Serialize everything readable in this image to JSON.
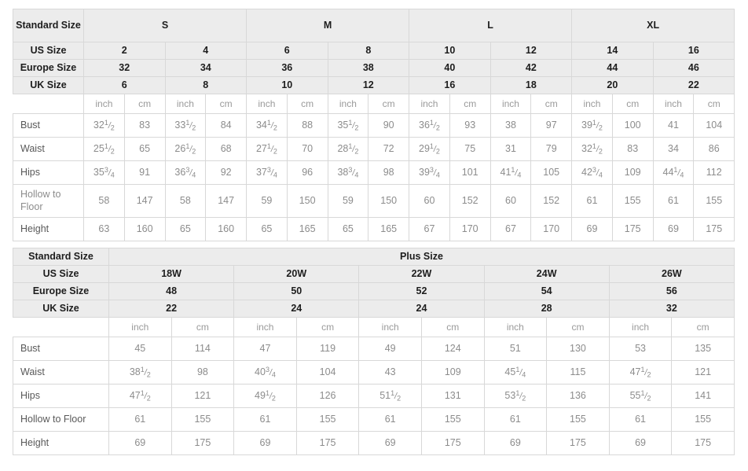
{
  "standard_table": {
    "label_header": "Standard Size",
    "size_groups": [
      {
        "name": "S",
        "span": 4
      },
      {
        "name": "M",
        "span": 4
      },
      {
        "name": "L",
        "span": 4
      },
      {
        "name": "XL",
        "span": 4
      }
    ],
    "size_rows": [
      {
        "label": "US Size",
        "values": [
          "2",
          "4",
          "6",
          "8",
          "10",
          "12",
          "14",
          "16"
        ]
      },
      {
        "label": "Europe Size",
        "values": [
          "32",
          "34",
          "36",
          "38",
          "40",
          "42",
          "44",
          "46"
        ]
      },
      {
        "label": "UK Size",
        "values": [
          "6",
          "8",
          "10",
          "12",
          "16",
          "18",
          "20",
          "22"
        ]
      }
    ],
    "unit_row": {
      "label": "",
      "units": [
        "inch",
        "cm",
        "inch",
        "cm",
        "inch",
        "cm",
        "inch",
        "cm",
        "inch",
        "cm",
        "inch",
        "cm",
        "inch",
        "cm",
        "inch",
        "cm"
      ]
    },
    "measure_rows": [
      {
        "label": "Bust",
        "tall": false,
        "cells": [
          {
            "whole": "32",
            "num": "1",
            "den": "2"
          },
          {
            "whole": "83"
          },
          {
            "whole": "33",
            "num": "1",
            "den": "2"
          },
          {
            "whole": "84"
          },
          {
            "whole": "34",
            "num": "1",
            "den": "2"
          },
          {
            "whole": "88"
          },
          {
            "whole": "35",
            "num": "1",
            "den": "2"
          },
          {
            "whole": "90"
          },
          {
            "whole": "36",
            "num": "1",
            "den": "2"
          },
          {
            "whole": "93"
          },
          {
            "whole": "38"
          },
          {
            "whole": "97"
          },
          {
            "whole": "39",
            "num": "1",
            "den": "2"
          },
          {
            "whole": "100"
          },
          {
            "whole": "41"
          },
          {
            "whole": "104"
          }
        ]
      },
      {
        "label": "Waist",
        "tall": false,
        "cells": [
          {
            "whole": "25",
            "num": "1",
            "den": "2"
          },
          {
            "whole": "65"
          },
          {
            "whole": "26",
            "num": "1",
            "den": "2"
          },
          {
            "whole": "68"
          },
          {
            "whole": "27",
            "num": "1",
            "den": "2"
          },
          {
            "whole": "70"
          },
          {
            "whole": "28",
            "num": "1",
            "den": "2"
          },
          {
            "whole": "72"
          },
          {
            "whole": "29",
            "num": "1",
            "den": "2"
          },
          {
            "whole": "75"
          },
          {
            "whole": "31"
          },
          {
            "whole": "79"
          },
          {
            "whole": "32",
            "num": "1",
            "den": "2"
          },
          {
            "whole": "83"
          },
          {
            "whole": "34"
          },
          {
            "whole": "86"
          }
        ]
      },
      {
        "label": "Hips",
        "tall": false,
        "cells": [
          {
            "whole": "35",
            "num": "3",
            "den": "4"
          },
          {
            "whole": "91"
          },
          {
            "whole": "36",
            "num": "3",
            "den": "4"
          },
          {
            "whole": "92"
          },
          {
            "whole": "37",
            "num": "3",
            "den": "4"
          },
          {
            "whole": "96"
          },
          {
            "whole": "38",
            "num": "3",
            "den": "4"
          },
          {
            "whole": "98"
          },
          {
            "whole": "39",
            "num": "3",
            "den": "4"
          },
          {
            "whole": "101"
          },
          {
            "whole": "41",
            "num": "1",
            "den": "4"
          },
          {
            "whole": "105"
          },
          {
            "whole": "42",
            "num": "3",
            "den": "4"
          },
          {
            "whole": "109"
          },
          {
            "whole": "44",
            "num": "1",
            "den": "4"
          },
          {
            "whole": "112"
          }
        ]
      },
      {
        "label": "Hollow to Floor",
        "tall": true,
        "cells": [
          {
            "whole": "58"
          },
          {
            "whole": "147"
          },
          {
            "whole": "58"
          },
          {
            "whole": "147"
          },
          {
            "whole": "59"
          },
          {
            "whole": "150"
          },
          {
            "whole": "59"
          },
          {
            "whole": "150"
          },
          {
            "whole": "60"
          },
          {
            "whole": "152"
          },
          {
            "whole": "60"
          },
          {
            "whole": "152"
          },
          {
            "whole": "61"
          },
          {
            "whole": "155"
          },
          {
            "whole": "61"
          },
          {
            "whole": "155"
          }
        ]
      },
      {
        "label": "Height",
        "tall": false,
        "cells": [
          {
            "whole": "63"
          },
          {
            "whole": "160"
          },
          {
            "whole": "65"
          },
          {
            "whole": "160"
          },
          {
            "whole": "65"
          },
          {
            "whole": "165"
          },
          {
            "whole": "65"
          },
          {
            "whole": "165"
          },
          {
            "whole": "67"
          },
          {
            "whole": "170"
          },
          {
            "whole": "67"
          },
          {
            "whole": "170"
          },
          {
            "whole": "69"
          },
          {
            "whole": "175"
          },
          {
            "whole": "69"
          },
          {
            "whole": "175"
          }
        ]
      }
    ]
  },
  "plus_table": {
    "label_header": "Standard Size",
    "group_header": "Plus Size",
    "size_rows": [
      {
        "label": "US Size",
        "values": [
          "18W",
          "20W",
          "22W",
          "24W",
          "26W"
        ]
      },
      {
        "label": "Europe Size",
        "values": [
          "48",
          "50",
          "52",
          "54",
          "56"
        ]
      },
      {
        "label": "UK Size",
        "values": [
          "22",
          "24",
          "24",
          "28",
          "32"
        ]
      }
    ],
    "unit_row": {
      "label": "",
      "units": [
        "inch",
        "cm",
        "inch",
        "cm",
        "inch",
        "cm",
        "inch",
        "cm",
        "inch",
        "cm"
      ]
    },
    "measure_rows": [
      {
        "label": "Bust",
        "cells": [
          {
            "whole": "45"
          },
          {
            "whole": "114"
          },
          {
            "whole": "47"
          },
          {
            "whole": "119"
          },
          {
            "whole": "49"
          },
          {
            "whole": "124"
          },
          {
            "whole": "51"
          },
          {
            "whole": "130"
          },
          {
            "whole": "53"
          },
          {
            "whole": "135"
          }
        ]
      },
      {
        "label": "Waist",
        "cells": [
          {
            "whole": "38",
            "num": "1",
            "den": "2"
          },
          {
            "whole": "98"
          },
          {
            "whole": "40",
            "num": "3",
            "den": "4"
          },
          {
            "whole": "104"
          },
          {
            "whole": "43"
          },
          {
            "whole": "109"
          },
          {
            "whole": "45",
            "num": "1",
            "den": "4"
          },
          {
            "whole": "115"
          },
          {
            "whole": "47",
            "num": "1",
            "den": "2"
          },
          {
            "whole": "121"
          }
        ]
      },
      {
        "label": "Hips",
        "cells": [
          {
            "whole": "47",
            "num": "1",
            "den": "2"
          },
          {
            "whole": "121"
          },
          {
            "whole": "49",
            "num": "1",
            "den": "2"
          },
          {
            "whole": "126"
          },
          {
            "whole": "51",
            "num": "1",
            "den": "2"
          },
          {
            "whole": "131"
          },
          {
            "whole": "53",
            "num": "1",
            "den": "2"
          },
          {
            "whole": "136"
          },
          {
            "whole": "55",
            "num": "1",
            "den": "2"
          },
          {
            "whole": "141"
          }
        ]
      },
      {
        "label": "Hollow to Floor",
        "cells": [
          {
            "whole": "61"
          },
          {
            "whole": "155"
          },
          {
            "whole": "61"
          },
          {
            "whole": "155"
          },
          {
            "whole": "61"
          },
          {
            "whole": "155"
          },
          {
            "whole": "61"
          },
          {
            "whole": "155"
          },
          {
            "whole": "61"
          },
          {
            "whole": "155"
          }
        ]
      },
      {
        "label": "Height",
        "cells": [
          {
            "whole": "69"
          },
          {
            "whole": "175"
          },
          {
            "whole": "69"
          },
          {
            "whole": "175"
          },
          {
            "whole": "69"
          },
          {
            "whole": "175"
          },
          {
            "whole": "69"
          },
          {
            "whole": "175"
          },
          {
            "whole": "69"
          },
          {
            "whole": "175"
          }
        ]
      }
    ]
  },
  "colors": {
    "header_bg": "#ececec",
    "border": "#d8d8d8",
    "header_text": "#1d1d1d",
    "value_text": "#8c8c8c",
    "label_text": "#595959"
  }
}
